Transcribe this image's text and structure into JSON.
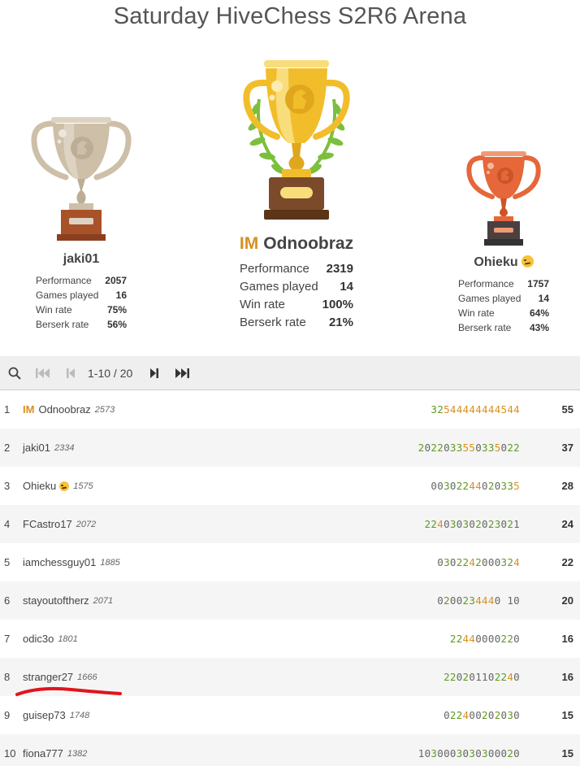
{
  "title": "Saturday HiveChess S2R6 Arena",
  "colors": {
    "accent_green": "#629924",
    "accent_orange": "#d59020",
    "gold": "#f2bd2b",
    "silver": "#cdbfa8",
    "bronze": "#e5673a",
    "annotation_red": "#e0151c"
  },
  "podium": {
    "first": {
      "title_badge": "IM",
      "name": "Odnoobraz",
      "stats": [
        {
          "label": "Performance",
          "value": "2319"
        },
        {
          "label": "Games played",
          "value": "14"
        },
        {
          "label": "Win rate",
          "value": "100%"
        },
        {
          "label": "Berserk rate",
          "value": "21%"
        }
      ]
    },
    "second": {
      "name": "jaki01",
      "stats": [
        {
          "label": "Performance",
          "value": "2057"
        },
        {
          "label": "Games played",
          "value": "16"
        },
        {
          "label": "Win rate",
          "value": "75%"
        },
        {
          "label": "Berserk rate",
          "value": "56%"
        }
      ]
    },
    "third": {
      "name": "Ohieku",
      "emoji": "smirk-emoji-icon",
      "stats": [
        {
          "label": "Performance",
          "value": "1757"
        },
        {
          "label": "Games played",
          "value": "14"
        },
        {
          "label": "Win rate",
          "value": "64%"
        },
        {
          "label": "Berserk rate",
          "value": "43%"
        }
      ]
    }
  },
  "pager": {
    "icons": [
      "search-icon",
      "first-page-icon",
      "prev-page-icon",
      "next-page-icon",
      "last-page-icon"
    ],
    "page_info": "1-10 / 20"
  },
  "standings": [
    {
      "rank": "1",
      "badge": "IM",
      "name": "Odnoobraz",
      "rating": "2573",
      "sheet": "32544444444544",
      "score": "55"
    },
    {
      "rank": "2",
      "badge": "",
      "name": "jaki01",
      "rating": "2334",
      "sheet": "2022033550335022",
      "score": "37"
    },
    {
      "rank": "3",
      "badge": "",
      "name": "Ohieku",
      "emoji": true,
      "rating": "1575",
      "sheet": "00302244020335",
      "score": "28"
    },
    {
      "rank": "4",
      "badge": "",
      "name": "FCastro17",
      "rating": "2072",
      "sheet": "224030302023021",
      "score": "24"
    },
    {
      "rank": "5",
      "badge": "",
      "name": "iamchessguy01",
      "rating": "1885",
      "sheet": "0302242000324",
      "score": "22"
    },
    {
      "rank": "6",
      "badge": "",
      "name": "stayoutoftherz",
      "rating": "2071",
      "sheet": "0200234440 10",
      "score": "20"
    },
    {
      "rank": "7",
      "badge": "",
      "name": "odic3o",
      "rating": "1801",
      "sheet": "22440000220",
      "score": "16"
    },
    {
      "rank": "8",
      "badge": "",
      "name": "stranger27",
      "rating": "1666",
      "sheet": "220201102240",
      "score": "16"
    },
    {
      "rank": "9",
      "badge": "",
      "name": "guisep73",
      "rating": "1748",
      "sheet": "022400202030",
      "score": "15"
    },
    {
      "rank": "10",
      "badge": "",
      "name": "fiona777",
      "rating": "1382",
      "sheet": "1030003030300020",
      "score": "15"
    }
  ]
}
